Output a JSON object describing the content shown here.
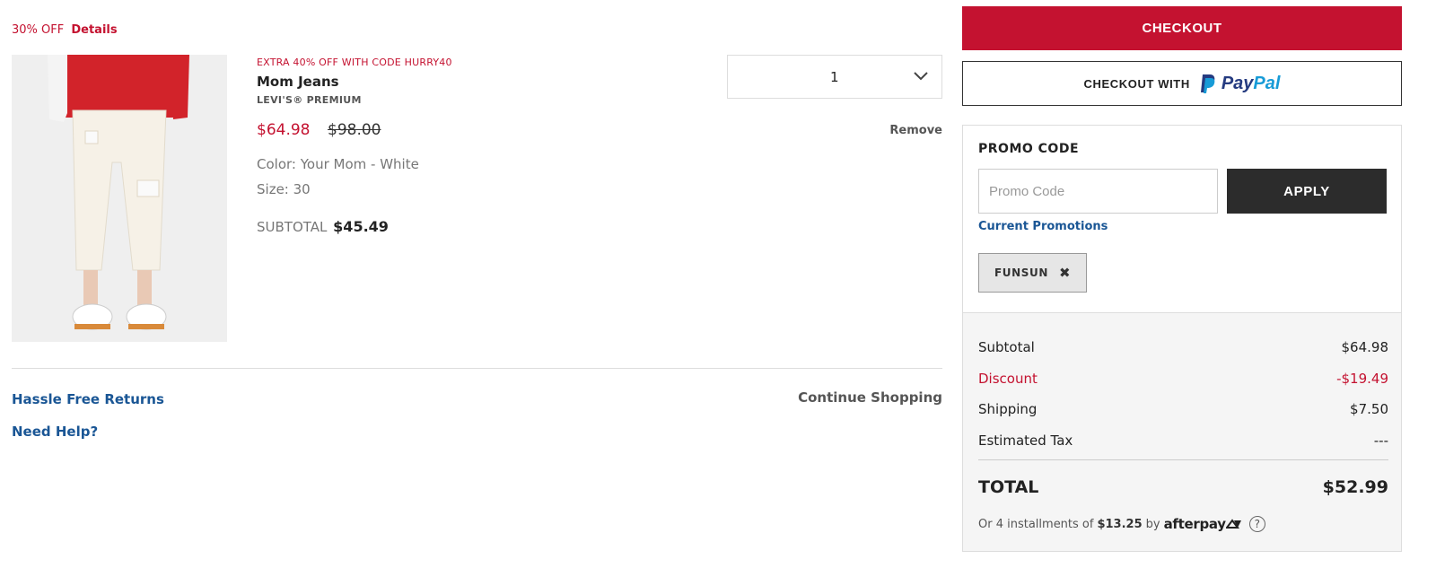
{
  "offer": {
    "text": "30% OFF",
    "details_label": "Details"
  },
  "product": {
    "promo_message": "EXTRA 40% OFF WITH CODE HURRY40",
    "name": "Mom Jeans",
    "brand": "LEVI'S® PREMIUM",
    "sale_price": "$64.98",
    "original_price": "$98.00",
    "color": "Color: Your Mom - White",
    "size": "Size: 30",
    "subtotal_label": "SUBTOTAL",
    "subtotal_value": "$45.49",
    "quantity": "1",
    "remove_label": "Remove"
  },
  "footer_links": {
    "returns": "Hassle Free Returns",
    "help": "Need Help?",
    "continue": "Continue Shopping"
  },
  "checkout": {
    "checkout_label": "CHECKOUT",
    "paypal_prefix": "CHECKOUT WITH",
    "paypal_pay": "Pay",
    "paypal_pal": "Pal"
  },
  "promo": {
    "title": "PROMO CODE",
    "placeholder": "Promo Code",
    "apply_label": "APPLY",
    "current_promotions": "Current Promotions",
    "applied_code": "FUNSUN",
    "remove_glyph": "✖"
  },
  "totals": {
    "subtotal_label": "Subtotal",
    "subtotal_value": "$64.98",
    "discount_label": "Discount",
    "discount_value": "-$19.49",
    "shipping_label": "Shipping",
    "shipping_value": "$7.50",
    "tax_label": "Estimated Tax",
    "tax_value": "---",
    "total_label": "TOTAL",
    "total_value": "$52.99",
    "installments_prefix": "Or 4 installments of",
    "installments_amount": "$13.25",
    "installments_by": "by",
    "afterpay_brand": "afterpay",
    "help_glyph": "?"
  },
  "colors": {
    "accent_red": "#c41230",
    "link_blue": "#1a5695",
    "dark_button": "#2c2c2c"
  }
}
